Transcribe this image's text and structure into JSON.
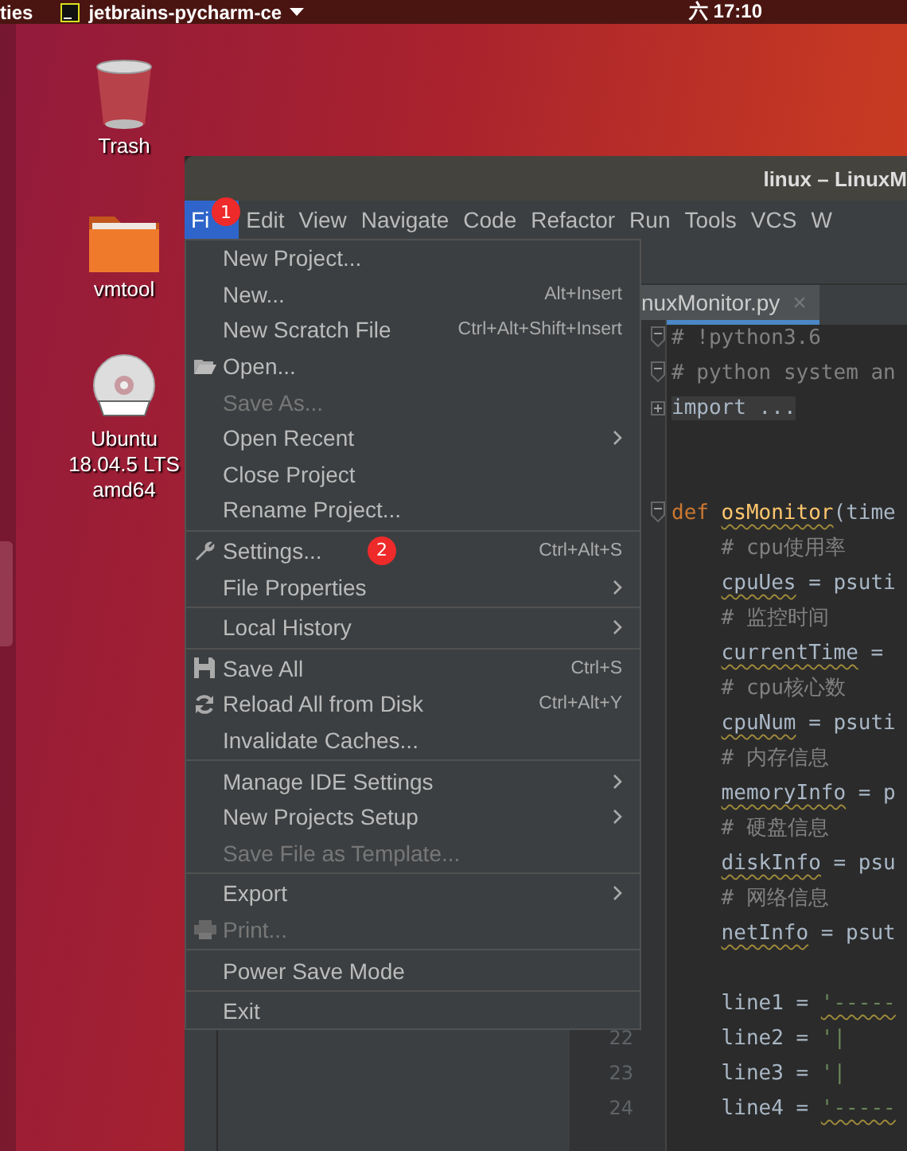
{
  "top_bar": {
    "activities": "ties",
    "app_menu": "jetbrains-pycharm-ce",
    "clock": "六 17:10"
  },
  "desktop_icons": [
    {
      "kind": "trash",
      "label": "Trash"
    },
    {
      "kind": "folder",
      "label": "vmtool"
    },
    {
      "kind": "dvd",
      "label": "Ubuntu 18.04.5 LTS amd64"
    }
  ],
  "window": {
    "title": "linux – LinuxM",
    "menu_bar": [
      {
        "label": "Fi",
        "selected": true,
        "badge": "1"
      },
      {
        "label": "Edit",
        "selected": false
      },
      {
        "label": "View",
        "selected": false
      },
      {
        "label": "Navigate",
        "selected": false
      },
      {
        "label": "Code",
        "selected": false
      },
      {
        "label": "Refactor",
        "selected": false
      },
      {
        "label": "Run",
        "selected": false
      },
      {
        "label": "Tools",
        "selected": false
      },
      {
        "label": "VCS",
        "selected": false
      },
      {
        "label": "W",
        "selected": false
      }
    ],
    "editor_tab": {
      "label": "nuxMonitor.py",
      "close": "×",
      "selected": true
    },
    "code_lines": [
      {
        "expanded": true,
        "tokens": [
          {
            "text": "# !python3.6",
            "kind": "comment"
          }
        ]
      },
      {
        "expanded": true,
        "tokens": [
          {
            "text": "# python system an",
            "kind": "comment"
          }
        ]
      },
      {
        "expanded": false,
        "tokens": [
          {
            "text": "import ...",
            "kind": "folded"
          }
        ]
      },
      {
        "spaced": true,
        "expanded": true,
        "tokens": [
          {
            "text": "def",
            "kind": "keyword"
          },
          {
            "text": "osMonitor",
            "kind": "function",
            "warn": true
          },
          {
            "text": "(time",
            "kind": "plain",
            "joined": true
          }
        ],
        "children": [
          {
            "tokens": [
              {
                "text": "# cpu使用率",
                "kind": "comment"
              }
            ]
          },
          {
            "tokens": [
              {
                "text": "cpuUes",
                "kind": "plain",
                "warn": true
              },
              {
                "text": "= psuti",
                "kind": "plain"
              }
            ]
          },
          {
            "tokens": [
              {
                "text": "# 监控时间",
                "kind": "comment"
              }
            ]
          },
          {
            "tokens": [
              {
                "text": "currentTime",
                "kind": "plain",
                "warn": true
              },
              {
                "text": "=",
                "kind": "plain"
              }
            ]
          },
          {
            "tokens": [
              {
                "text": "# cpu核心数",
                "kind": "comment"
              }
            ]
          },
          {
            "tokens": [
              {
                "text": "cpuNum",
                "kind": "plain",
                "warn": true
              },
              {
                "text": "= psuti",
                "kind": "plain"
              }
            ]
          },
          {
            "tokens": [
              {
                "text": "# 内存信息",
                "kind": "comment"
              }
            ]
          },
          {
            "tokens": [
              {
                "text": "memoryInfo",
                "kind": "plain",
                "warn": true
              },
              {
                "text": "= p",
                "kind": "plain"
              }
            ]
          },
          {
            "tokens": [
              {
                "text": "# 硬盘信息",
                "kind": "comment"
              }
            ]
          },
          {
            "tokens": [
              {
                "text": "diskInfo",
                "kind": "plain",
                "warn": true
              },
              {
                "text": "= psu",
                "kind": "plain"
              }
            ]
          },
          {
            "tokens": [
              {
                "text": "# 网络信息",
                "kind": "comment"
              }
            ]
          },
          {
            "tokens": [
              {
                "text": "netInfo",
                "kind": "plain",
                "warn": true
              },
              {
                "text": "= psut",
                "kind": "plain"
              }
            ]
          },
          {
            "spaced": true,
            "tokens": [
              {
                "text": "line1 =",
                "kind": "plain"
              },
              {
                "text": "'-----",
                "kind": "string",
                "warn": true
              }
            ]
          },
          {
            "number": "22",
            "tokens": [
              {
                "text": "line2 =",
                "kind": "plain"
              },
              {
                "text": "'|",
                "kind": "string"
              }
            ]
          },
          {
            "number": "23",
            "tokens": [
              {
                "text": "line3 =",
                "kind": "plain"
              },
              {
                "text": "'|",
                "kind": "string"
              }
            ]
          },
          {
            "number": "24",
            "tokens": [
              {
                "text": "line4 =",
                "kind": "plain"
              },
              {
                "text": "'-----",
                "kind": "string",
                "warn": true
              }
            ]
          }
        ]
      }
    ]
  },
  "file_menu": [
    {
      "kind": "item",
      "label": "New Project...",
      "disabled": false
    },
    {
      "kind": "item",
      "label": "New...",
      "shortcut": "Alt+Insert",
      "disabled": false
    },
    {
      "kind": "item",
      "label": "New Scratch File",
      "shortcut": "Ctrl+Alt+Shift+Insert",
      "disabled": false
    },
    {
      "kind": "folder",
      "label": "Open...",
      "disabled": false
    },
    {
      "kind": "item",
      "label": "Save As...",
      "disabled": true
    },
    {
      "kind": "item",
      "label": "Open Recent",
      "submenu": true,
      "disabled": false
    },
    {
      "kind": "item",
      "label": "Close Project",
      "disabled": false
    },
    {
      "kind": "item",
      "label": "Rename Project...",
      "disabled": false
    },
    {
      "kind": "separator"
    },
    {
      "kind": "wrench",
      "label": "Settings...",
      "shortcut": "Ctrl+Alt+S",
      "badge": "2",
      "disabled": false
    },
    {
      "kind": "item",
      "label": "File Properties",
      "submenu": true,
      "disabled": false
    },
    {
      "kind": "separator"
    },
    {
      "kind": "item",
      "label": "Local History",
      "submenu": true,
      "disabled": false
    },
    {
      "kind": "separator"
    },
    {
      "kind": "save",
      "label": "Save All",
      "shortcut": "Ctrl+S",
      "disabled": false
    },
    {
      "kind": "reload",
      "label": "Reload All from Disk",
      "shortcut": "Ctrl+Alt+Y",
      "disabled": false
    },
    {
      "kind": "item",
      "label": "Invalidate Caches...",
      "disabled": false
    },
    {
      "kind": "separator"
    },
    {
      "kind": "item",
      "label": "Manage IDE Settings",
      "submenu": true,
      "disabled": false
    },
    {
      "kind": "item",
      "label": "New Projects Setup",
      "submenu": true,
      "disabled": false
    },
    {
      "kind": "item",
      "label": "Save File as Template...",
      "disabled": true
    },
    {
      "kind": "separator"
    },
    {
      "kind": "item",
      "label": "Export",
      "submenu": true,
      "disabled": false
    },
    {
      "kind": "printer",
      "label": "Print...",
      "disabled": true
    },
    {
      "kind": "separator"
    },
    {
      "kind": "item",
      "label": "Power Save Mode",
      "disabled": false
    },
    {
      "kind": "separator"
    },
    {
      "kind": "item",
      "label": "Exit",
      "disabled": false
    }
  ]
}
